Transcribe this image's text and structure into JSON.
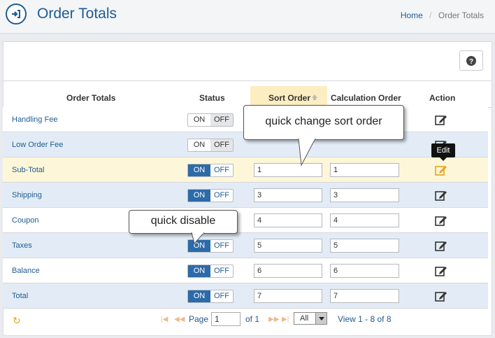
{
  "header": {
    "title": "Order Totals",
    "breadcrumb": {
      "home": "Home",
      "current": "Order Totals"
    }
  },
  "table": {
    "headers": {
      "name": "Order Totals",
      "status": "Status",
      "sort_order": "Sort Order",
      "calc_order": "Calculation Order",
      "action": "Action"
    },
    "rows": [
      {
        "name": "Handling Fee",
        "status": "OFF",
        "sort_order": "",
        "calc_order": ""
      },
      {
        "name": "Low Order Fee",
        "status": "OFF",
        "sort_order": "",
        "calc_order": ""
      },
      {
        "name": "Sub-Total",
        "status": "ON",
        "sort_order": "1",
        "calc_order": "1"
      },
      {
        "name": "Shipping",
        "status": "ON",
        "sort_order": "3",
        "calc_order": "3"
      },
      {
        "name": "Coupon",
        "status": "ON",
        "sort_order": "4",
        "calc_order": "4"
      },
      {
        "name": "Taxes",
        "status": "ON",
        "sort_order": "5",
        "calc_order": "5"
      },
      {
        "name": "Balance",
        "status": "ON",
        "sort_order": "6",
        "calc_order": "6"
      },
      {
        "name": "Total",
        "status": "ON",
        "sort_order": "7",
        "calc_order": "7"
      }
    ],
    "toggle_on": "ON",
    "toggle_off": "OFF",
    "edit_tooltip": "Edit"
  },
  "callouts": {
    "sort": "quick change sort order",
    "disable": "quick disable"
  },
  "pager": {
    "page_label": "Page",
    "page_value": "1",
    "of_label": "of 1",
    "per_page": "All",
    "view_text": "View 1 - 8 of 8"
  },
  "colors": {
    "accent": "#1f5c91",
    "toggle_on": "#2c6aa8",
    "row_alt": "#e3ecf6",
    "row_highlight": "#fdf6d8",
    "sorted_header": "#fdeec2"
  }
}
